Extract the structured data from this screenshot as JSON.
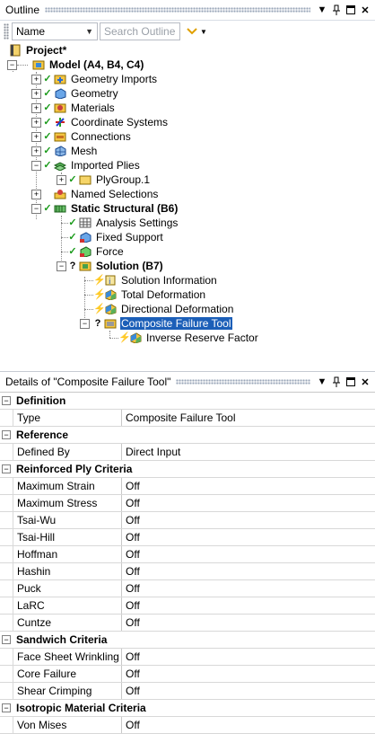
{
  "outline": {
    "title": "Outline",
    "filter_combo": "Name",
    "search_placeholder": "Search Outline",
    "tree": {
      "project": "Project*",
      "model": "Model (A4, B4, C4)",
      "geometry_imports": "Geometry Imports",
      "geometry": "Geometry",
      "materials": "Materials",
      "coordinate_systems": "Coordinate Systems",
      "connections": "Connections",
      "mesh": "Mesh",
      "imported_plies": "Imported Plies",
      "plygroup": "PlyGroup.1",
      "named_selections": "Named Selections",
      "static_structural": "Static Structural (B6)",
      "analysis_settings": "Analysis Settings",
      "fixed_support": "Fixed Support",
      "force": "Force",
      "solution": "Solution (B7)",
      "solution_information": "Solution Information",
      "total_deformation": "Total Deformation",
      "directional_deformation": "Directional Deformation",
      "composite_failure_tool": "Composite Failure Tool",
      "inverse_reserve_factor": "Inverse Reserve Factor"
    }
  },
  "details": {
    "title": "Details of \"Composite Failure Tool\"",
    "sections": [
      {
        "name": "Definition",
        "rows": [
          {
            "k": "Type",
            "v": "Composite Failure Tool"
          }
        ]
      },
      {
        "name": "Reference",
        "rows": [
          {
            "k": "Defined By",
            "v": "Direct Input"
          }
        ]
      },
      {
        "name": "Reinforced Ply Criteria",
        "rows": [
          {
            "k": "Maximum Strain",
            "v": "Off"
          },
          {
            "k": "Maximum Stress",
            "v": "Off"
          },
          {
            "k": "Tsai-Wu",
            "v": "Off"
          },
          {
            "k": "Tsai-Hill",
            "v": "Off"
          },
          {
            "k": "Hoffman",
            "v": "Off"
          },
          {
            "k": "Hashin",
            "v": "Off"
          },
          {
            "k": "Puck",
            "v": "Off"
          },
          {
            "k": "LaRC",
            "v": "Off"
          },
          {
            "k": "Cuntze",
            "v": "Off"
          }
        ]
      },
      {
        "name": "Sandwich Criteria",
        "rows": [
          {
            "k": "Face Sheet Wrinkling",
            "v": "Off"
          },
          {
            "k": "Core Failure",
            "v": "Off"
          },
          {
            "k": "Shear Crimping",
            "v": "Off"
          }
        ]
      },
      {
        "name": "Isotropic Material Criteria",
        "rows": [
          {
            "k": "Von Mises",
            "v": "Off"
          }
        ]
      }
    ]
  },
  "colors": {
    "selection": "#1c5fb8",
    "check": "#1a9a1a",
    "bolt": "#d9a400"
  }
}
